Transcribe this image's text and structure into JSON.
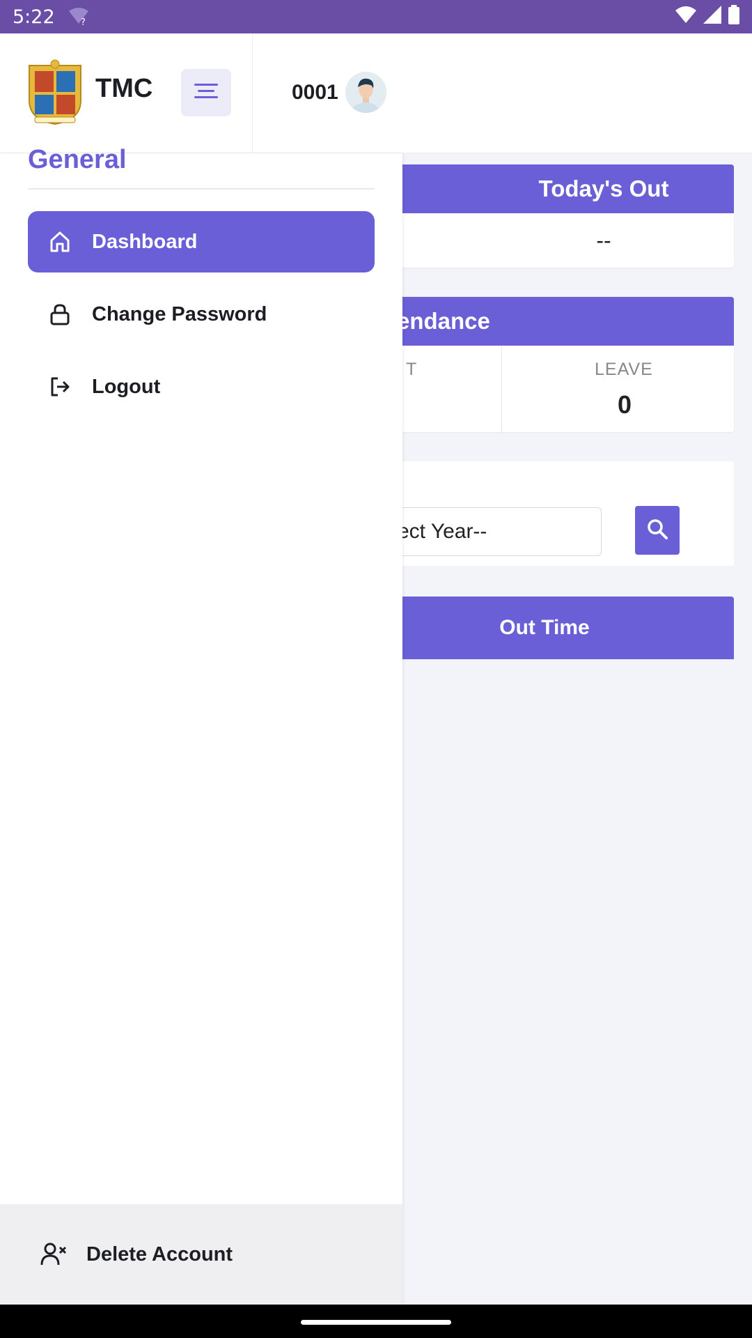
{
  "status_bar": {
    "time": "5:22",
    "wifi_badge": "?"
  },
  "header": {
    "brand": "TMC",
    "user_id": "0001"
  },
  "dashboard": {
    "todays_out": {
      "title": "Today's Out",
      "value": "--"
    },
    "attendance": {
      "title": "endance",
      "col1_label": "T",
      "col2_label": "LEAVE",
      "col2_value": "0"
    },
    "filter": {
      "year_placeholder": "ect Year--"
    },
    "out_time": {
      "title": "Out Time"
    }
  },
  "drawer": {
    "section_title": "General",
    "items": [
      {
        "label": "Dashboard",
        "icon": "home-icon",
        "active": true
      },
      {
        "label": "Change Password",
        "icon": "lock-icon",
        "active": false
      },
      {
        "label": "Logout",
        "icon": "logout-icon",
        "active": false
      }
    ],
    "footer": {
      "label": "Delete Account",
      "icon": "user-remove-icon"
    }
  },
  "colors": {
    "primary": "#6a5fd6",
    "status_bar": "#6a4da5",
    "background": "#f3f4f9"
  }
}
